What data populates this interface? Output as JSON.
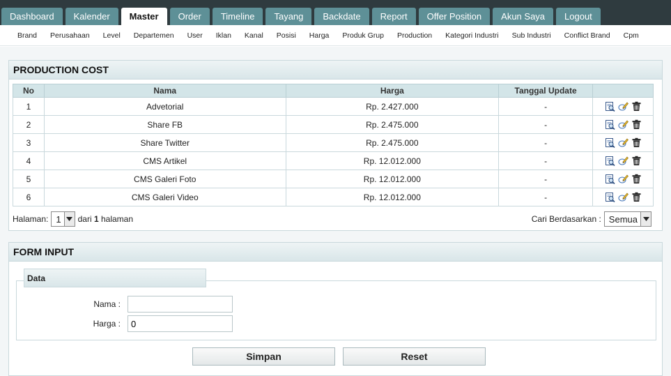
{
  "topnav": [
    "Dashboard",
    "Kalender",
    "Master",
    "Order",
    "Timeline",
    "Tayang",
    "Backdate",
    "Report",
    "Offer Position",
    "Akun Saya",
    "Logout"
  ],
  "subnav": [
    "Brand",
    "Perusahaan",
    "Level",
    "Departemen",
    "User",
    "Iklan",
    "Kanal",
    "Posisi",
    "Harga",
    "Produk Grup",
    "Production",
    "Kategori Industri",
    "Sub Industri",
    "Conflict Brand",
    "Cpm"
  ],
  "production": {
    "title": "PRODUCTION COST",
    "headers": [
      "No",
      "Nama",
      "Harga",
      "Tanggal Update",
      ""
    ],
    "rows": [
      {
        "no": "1",
        "nama": "Advetorial",
        "harga": "Rp. 2.427.000",
        "tgl": "-"
      },
      {
        "no": "2",
        "nama": "Share FB",
        "harga": "Rp. 2.475.000",
        "tgl": "-"
      },
      {
        "no": "3",
        "nama": "Share Twitter",
        "harga": "Rp. 2.475.000",
        "tgl": "-"
      },
      {
        "no": "4",
        "nama": "CMS Artikel",
        "harga": "Rp. 12.012.000",
        "tgl": "-"
      },
      {
        "no": "5",
        "nama": "CMS Galeri Foto",
        "harga": "Rp. 12.012.000",
        "tgl": "-"
      },
      {
        "no": "6",
        "nama": "CMS Galeri Video",
        "harga": "Rp. 12.012.000",
        "tgl": "-"
      }
    ],
    "pager": {
      "label": "Halaman:",
      "page": "1",
      "of": "dari",
      "total": "1",
      "unit": "halaman"
    },
    "search": {
      "label": "Cari Berdasarkan :",
      "value": "Semua"
    }
  },
  "form": {
    "title": "FORM INPUT",
    "legend": "Data",
    "nama_label": "Nama :",
    "nama_value": "",
    "harga_label": "Harga :",
    "harga_value": "0",
    "save": "Simpan",
    "reset": "Reset"
  },
  "colors": {
    "topbar": "#2f3b3f",
    "tab": "#5e9097",
    "header_bg": "#d3e5e8"
  }
}
